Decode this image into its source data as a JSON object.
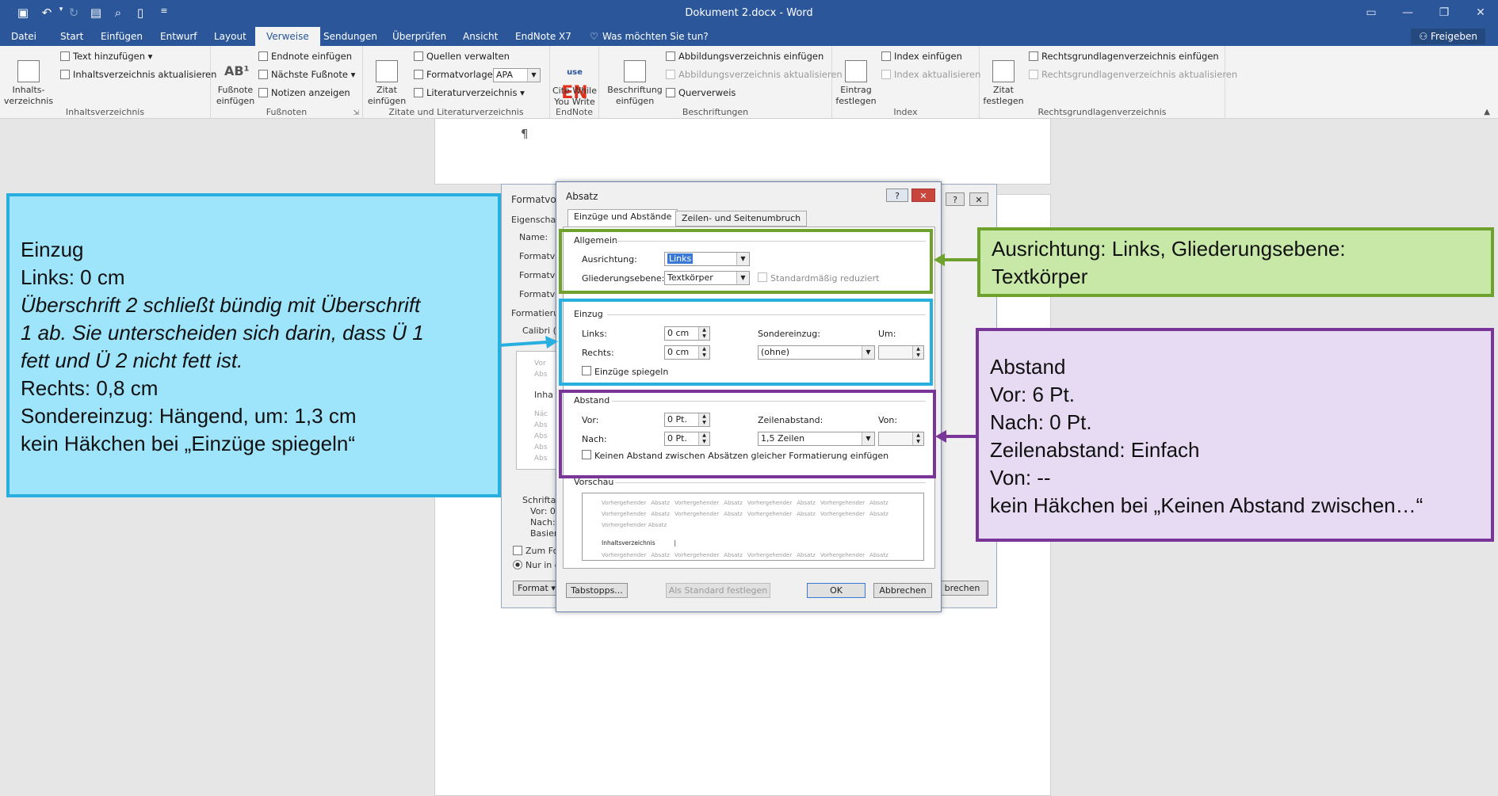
{
  "titlebar": {
    "title": "Dokument 2.docx - Word",
    "quick_access": [
      "save-icon",
      "undo-icon",
      "redo-icon",
      "save-as-icon",
      "print-preview-icon",
      "new-doc-icon",
      "customize-icon"
    ]
  },
  "tabs": [
    "Datei",
    "Start",
    "Einfügen",
    "Entwurf",
    "Layout",
    "Verweise",
    "Sendungen",
    "Überprüfen",
    "Ansicht",
    "EndNote X7"
  ],
  "tell_me": "Was möchten Sie tun?",
  "share": "Freigeben",
  "ribbon": {
    "toc": {
      "big": "Inhalts-\nverzeichnis",
      "add_text": "Text hinzufügen",
      "update": "Inhaltsverzeichnis aktualisieren",
      "label": "Inhaltsverzeichnis"
    },
    "footnotes": {
      "big": "Fußnote\neinfügen",
      "endnote": "Endnote einfügen",
      "next": "Nächste Fußnote",
      "show": "Notizen anzeigen",
      "label": "Fußnoten"
    },
    "citations": {
      "big": "Zitat\neinfügen",
      "manage": "Quellen verwalten",
      "style_label": "Formatvorlage:",
      "style_value": "APA",
      "bib": "Literaturverzeichnis",
      "label": "Zitate und Literaturverzeichnis"
    },
    "endnote": {
      "logo_small": "use",
      "logo_big": "EN",
      "big": "Cite While\nYou Write",
      "label": "EndNote"
    },
    "captions": {
      "big": "Beschriftung\neinfügen",
      "insert_tof": "Abbildungsverzeichnis einfügen",
      "update_tof": "Abbildungsverzeichnis aktualisieren",
      "cross": "Querverweis",
      "label": "Beschriftungen"
    },
    "index": {
      "big": "Eintrag\nfestlegen",
      "insert": "Index einfügen",
      "update": "Index aktualisieren",
      "label": "Index"
    },
    "authorities": {
      "big": "Zitat\nfestlegen",
      "insert": "Rechtsgrundlagenverzeichnis einfügen",
      "update": "Rechtsgrundlagenverzeichnis aktualisieren",
      "label": "Rechtsgrundlagenverzeichnis"
    }
  },
  "document": {
    "pilcrow": "¶"
  },
  "bg_dialog": {
    "title": "Formatvorl",
    "labels": [
      "Eigenschaf",
      "Name:",
      "Formatvo",
      "Formatvo",
      "Formatvo",
      "Formatierun",
      "Calibri (T",
      "Vor",
      "Abs",
      "Inha",
      "Näc",
      "Abs",
      "Abs",
      "Abs",
      "Abs",
      "Schriftar",
      "Vor: 0",
      "Nach:",
      "Basier",
      "Zum Fo",
      "Nur in d"
    ],
    "format_button": "Format",
    "cancel_fragment": "brechen"
  },
  "absatz": {
    "title": "Absatz",
    "tabs": [
      "Einzüge und Abstände",
      "Zeilen- und Seitenumbruch"
    ],
    "general": {
      "legend": "Allgemein",
      "align_label": "Ausrichtung:",
      "align_value": "Links",
      "outline_label": "Gliederungsebene:",
      "outline_value": "Textkörper",
      "collapsed_label": "Standardmäßig reduziert"
    },
    "indent": {
      "legend": "Einzug",
      "left_label": "Links:",
      "left_value": "0 cm",
      "right_label": "Rechts:",
      "right_value": "0 cm",
      "special_label": "Sondereinzug:",
      "special_value": "(ohne)",
      "by_label": "Um:",
      "by_value": "",
      "mirror_label": "Einzüge spiegeln"
    },
    "spacing": {
      "legend": "Abstand",
      "before_label": "Vor:",
      "before_value": "0 Pt.",
      "after_label": "Nach:",
      "after_value": "0 Pt.",
      "line_label": "Zeilenabstand:",
      "line_value": "1,5 Zeilen",
      "at_label": "Von:",
      "at_value": "",
      "nospace_label": "Keinen Abstand zwischen Absätzen gleicher Formatierung einfügen"
    },
    "preview": {
      "legend": "Vorschau",
      "prev_words": [
        "Vorhergehender",
        "Absatz",
        "Vorhergehender",
        "Absatz",
        "Vorhergehender",
        "Absatz",
        "Vorhergehender",
        "Absatz"
      ],
      "last_prev": "Vorhergehender Absatz",
      "sample": "Inhaltsverzeichnis"
    },
    "buttons": {
      "tabs": "Tabstopps...",
      "default": "Als Standard festlegen",
      "ok": "OK",
      "cancel": "Abbrechen"
    }
  },
  "annotations": {
    "einzug": {
      "lines": [
        "Einzug",
        "Links: 0 cm"
      ],
      "italic": [
        "Überschrift 2 schließt bündig mit Überschrift",
        "1 ab. Sie unterscheiden sich darin, dass Ü 1",
        "fett und Ü 2 nicht fett ist."
      ],
      "rest": [
        "Rechts: 0,8 cm",
        "Sondereinzug: Hängend, um: 1,3 cm",
        "kein Häkchen bei „Einzüge spiegeln“"
      ],
      "color": "#29aee0",
      "bg": "#9ee4fb"
    },
    "ausrichtung": {
      "lines": [
        "Ausrichtung: Links, Gliederungsebene:",
        "Textkörper"
      ],
      "color": "#6ea22d",
      "bg": "#c7e8a6"
    },
    "abstand": {
      "lines": [
        "Abstand",
        "Vor: 6 Pt.",
        "Nach: 0 Pt.",
        "Zeilenabstand: Einfach",
        "Von: --",
        "kein Häkchen bei „Keinen Abstand zwischen…“"
      ],
      "color": "#7a3599",
      "bg": "#e7dbf3"
    }
  }
}
